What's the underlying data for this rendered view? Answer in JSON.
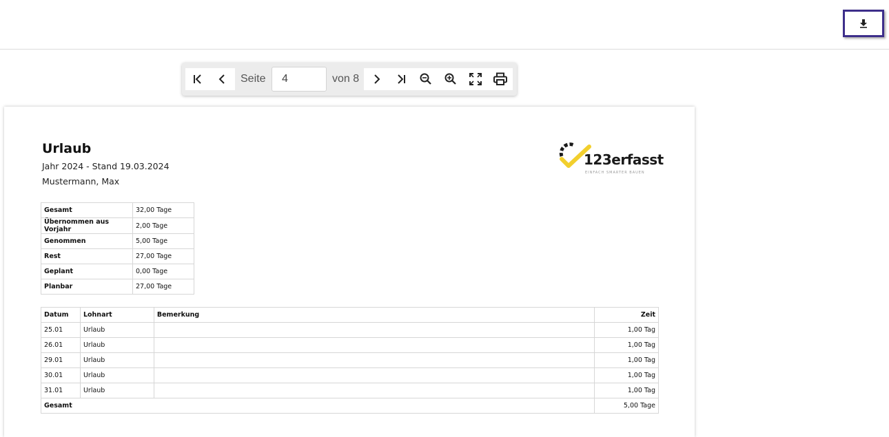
{
  "toolbar": {
    "page_label": "Seite",
    "page_value": "4",
    "of_label": "von 8"
  },
  "icons": {
    "download": "download-icon",
    "first_page": "first-page-icon",
    "prev_page": "chevron-left-icon",
    "next_page": "chevron-right-icon",
    "last_page": "last-page-icon",
    "zoom_out": "zoom-out-icon",
    "zoom_in": "zoom-in-icon",
    "fullscreen": "fullscreen-icon",
    "print": "print-icon"
  },
  "colors": {
    "accent_border": "#3d2e8a",
    "logo_yellow": "#f2cf2d",
    "logo_black": "#1a1a1a"
  },
  "document": {
    "title": "Urlaub",
    "subtitle": "Jahr 2024 - Stand 19.03.2024",
    "person": "Mustermann, Max",
    "logo_text": "123erfasst",
    "logo_tagline": "EINFACH SMARTER BAUEN",
    "summary": [
      {
        "label": "Gesamt",
        "value": "32,00 Tage"
      },
      {
        "label": "Übernommen aus Vorjahr",
        "value": "2,00 Tage"
      },
      {
        "label": "Genommen",
        "value": "5,00 Tage"
      },
      {
        "label": "Rest",
        "value": "27,00 Tage"
      },
      {
        "label": "Geplant",
        "value": "0,00 Tage"
      },
      {
        "label": "Planbar",
        "value": "27,00 Tage"
      }
    ],
    "entries": {
      "headers": {
        "datum": "Datum",
        "lohnart": "Lohnart",
        "bemerkung": "Bemerkung",
        "zeit": "Zeit"
      },
      "rows": [
        {
          "datum": "25.01",
          "lohnart": "Urlaub",
          "bemerkung": "",
          "zeit": "1,00 Tag"
        },
        {
          "datum": "26.01",
          "lohnart": "Urlaub",
          "bemerkung": "",
          "zeit": "1,00 Tag"
        },
        {
          "datum": "29.01",
          "lohnart": "Urlaub",
          "bemerkung": "",
          "zeit": "1,00 Tag"
        },
        {
          "datum": "30.01",
          "lohnart": "Urlaub",
          "bemerkung": "",
          "zeit": "1,00 Tag"
        },
        {
          "datum": "31.01",
          "lohnart": "Urlaub",
          "bemerkung": "",
          "zeit": "1,00 Tag"
        }
      ],
      "total_label": "Gesamt",
      "total_value": "5,00 Tage"
    }
  }
}
